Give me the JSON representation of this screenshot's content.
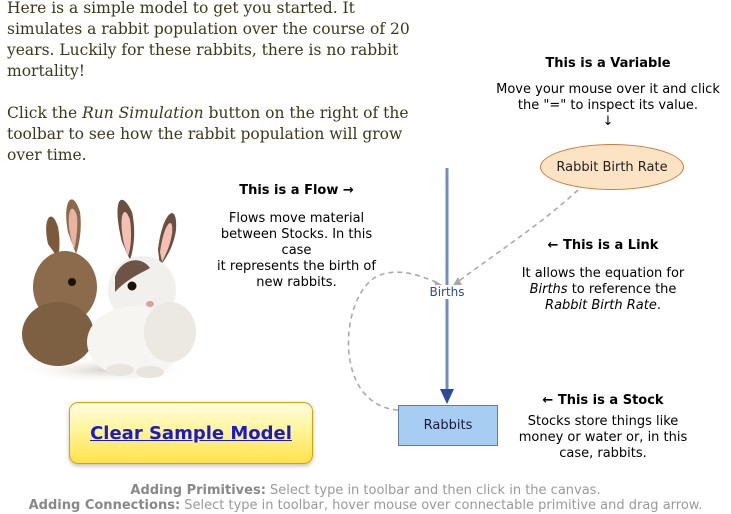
{
  "intro": {
    "p1": "Here is a simple model to get you started. It simulates a rabbit population over the course of 20 years. Luckily for these rabbits, there is no rabbit mortality!",
    "p2_before": "Click the ",
    "p2_em": "Run Simulation",
    "p2_after": " button on the right of the toolbar to see how the rabbit population will grow over time."
  },
  "annotations": {
    "variable": {
      "title": "This is a Variable",
      "body1": "Move your mouse over it and click",
      "body2": "the \"=\" to inspect its value.",
      "arrow": "↓"
    },
    "flow": {
      "title": "This is a Flow →",
      "body1": "Flows move material",
      "body2": "between Stocks. In this case",
      "body3": "it represents the birth of",
      "body4": "new rabbits."
    },
    "link": {
      "title": "← This is a Link",
      "body1": "It allows the equation for",
      "body2_em": "Births",
      "body2_rest": " to reference the",
      "body3_em": "Rabbit Birth Rate",
      "body3_rest": "."
    },
    "stock": {
      "title": "← This is a Stock",
      "body1": "Stocks store things like",
      "body2": "money or water or, in this",
      "body3": "case, rabbits."
    }
  },
  "model": {
    "variable_name": "Rabbit Birth Rate",
    "flow_name": "Births",
    "stock_name": "Rabbits"
  },
  "clear_button": {
    "label": "Clear Sample Model"
  },
  "footer": {
    "primitives_label": "Adding Primitives:",
    "primitives_text": " Select type in toolbar and then click in the canvas.",
    "connections_label": "Adding Connections:",
    "connections_text": " Select type in toolbar, hover mouse over connectable primitive and drag arrow."
  },
  "colors": {
    "flow": "#6f8ec8",
    "link": "#aaaaaa",
    "variable_fill": "#fce3c4",
    "stock_fill": "#a7cdf3",
    "button_text": "#1a1acc"
  }
}
